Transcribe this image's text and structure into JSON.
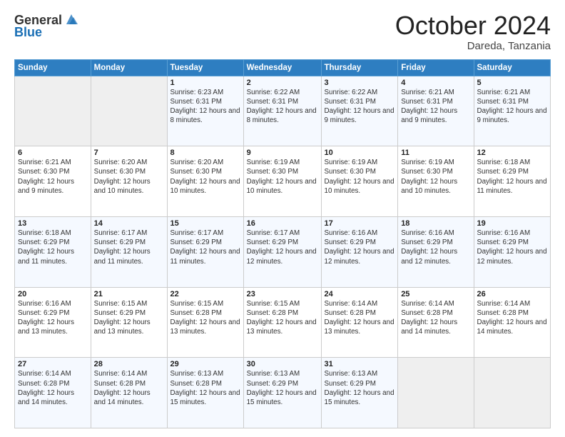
{
  "logo": {
    "general": "General",
    "blue": "Blue"
  },
  "title": "October 2024",
  "location": "Dareda, Tanzania",
  "days_of_week": [
    "Sunday",
    "Monday",
    "Tuesday",
    "Wednesday",
    "Thursday",
    "Friday",
    "Saturday"
  ],
  "weeks": [
    [
      {
        "day": "",
        "info": ""
      },
      {
        "day": "",
        "info": ""
      },
      {
        "day": "1",
        "info": "Sunrise: 6:23 AM\nSunset: 6:31 PM\nDaylight: 12 hours and 8 minutes."
      },
      {
        "day": "2",
        "info": "Sunrise: 6:22 AM\nSunset: 6:31 PM\nDaylight: 12 hours and 8 minutes."
      },
      {
        "day": "3",
        "info": "Sunrise: 6:22 AM\nSunset: 6:31 PM\nDaylight: 12 hours and 9 minutes."
      },
      {
        "day": "4",
        "info": "Sunrise: 6:21 AM\nSunset: 6:31 PM\nDaylight: 12 hours and 9 minutes."
      },
      {
        "day": "5",
        "info": "Sunrise: 6:21 AM\nSunset: 6:31 PM\nDaylight: 12 hours and 9 minutes."
      }
    ],
    [
      {
        "day": "6",
        "info": "Sunrise: 6:21 AM\nSunset: 6:30 PM\nDaylight: 12 hours and 9 minutes."
      },
      {
        "day": "7",
        "info": "Sunrise: 6:20 AM\nSunset: 6:30 PM\nDaylight: 12 hours and 10 minutes."
      },
      {
        "day": "8",
        "info": "Sunrise: 6:20 AM\nSunset: 6:30 PM\nDaylight: 12 hours and 10 minutes."
      },
      {
        "day": "9",
        "info": "Sunrise: 6:19 AM\nSunset: 6:30 PM\nDaylight: 12 hours and 10 minutes."
      },
      {
        "day": "10",
        "info": "Sunrise: 6:19 AM\nSunset: 6:30 PM\nDaylight: 12 hours and 10 minutes."
      },
      {
        "day": "11",
        "info": "Sunrise: 6:19 AM\nSunset: 6:30 PM\nDaylight: 12 hours and 10 minutes."
      },
      {
        "day": "12",
        "info": "Sunrise: 6:18 AM\nSunset: 6:29 PM\nDaylight: 12 hours and 11 minutes."
      }
    ],
    [
      {
        "day": "13",
        "info": "Sunrise: 6:18 AM\nSunset: 6:29 PM\nDaylight: 12 hours and 11 minutes."
      },
      {
        "day": "14",
        "info": "Sunrise: 6:17 AM\nSunset: 6:29 PM\nDaylight: 12 hours and 11 minutes."
      },
      {
        "day": "15",
        "info": "Sunrise: 6:17 AM\nSunset: 6:29 PM\nDaylight: 12 hours and 11 minutes."
      },
      {
        "day": "16",
        "info": "Sunrise: 6:17 AM\nSunset: 6:29 PM\nDaylight: 12 hours and 12 minutes."
      },
      {
        "day": "17",
        "info": "Sunrise: 6:16 AM\nSunset: 6:29 PM\nDaylight: 12 hours and 12 minutes."
      },
      {
        "day": "18",
        "info": "Sunrise: 6:16 AM\nSunset: 6:29 PM\nDaylight: 12 hours and 12 minutes."
      },
      {
        "day": "19",
        "info": "Sunrise: 6:16 AM\nSunset: 6:29 PM\nDaylight: 12 hours and 12 minutes."
      }
    ],
    [
      {
        "day": "20",
        "info": "Sunrise: 6:16 AM\nSunset: 6:29 PM\nDaylight: 12 hours and 13 minutes."
      },
      {
        "day": "21",
        "info": "Sunrise: 6:15 AM\nSunset: 6:29 PM\nDaylight: 12 hours and 13 minutes."
      },
      {
        "day": "22",
        "info": "Sunrise: 6:15 AM\nSunset: 6:28 PM\nDaylight: 12 hours and 13 minutes."
      },
      {
        "day": "23",
        "info": "Sunrise: 6:15 AM\nSunset: 6:28 PM\nDaylight: 12 hours and 13 minutes."
      },
      {
        "day": "24",
        "info": "Sunrise: 6:14 AM\nSunset: 6:28 PM\nDaylight: 12 hours and 13 minutes."
      },
      {
        "day": "25",
        "info": "Sunrise: 6:14 AM\nSunset: 6:28 PM\nDaylight: 12 hours and 14 minutes."
      },
      {
        "day": "26",
        "info": "Sunrise: 6:14 AM\nSunset: 6:28 PM\nDaylight: 12 hours and 14 minutes."
      }
    ],
    [
      {
        "day": "27",
        "info": "Sunrise: 6:14 AM\nSunset: 6:28 PM\nDaylight: 12 hours and 14 minutes."
      },
      {
        "day": "28",
        "info": "Sunrise: 6:14 AM\nSunset: 6:28 PM\nDaylight: 12 hours and 14 minutes."
      },
      {
        "day": "29",
        "info": "Sunrise: 6:13 AM\nSunset: 6:28 PM\nDaylight: 12 hours and 15 minutes."
      },
      {
        "day": "30",
        "info": "Sunrise: 6:13 AM\nSunset: 6:29 PM\nDaylight: 12 hours and 15 minutes."
      },
      {
        "day": "31",
        "info": "Sunrise: 6:13 AM\nSunset: 6:29 PM\nDaylight: 12 hours and 15 minutes."
      },
      {
        "day": "",
        "info": ""
      },
      {
        "day": "",
        "info": ""
      }
    ]
  ]
}
